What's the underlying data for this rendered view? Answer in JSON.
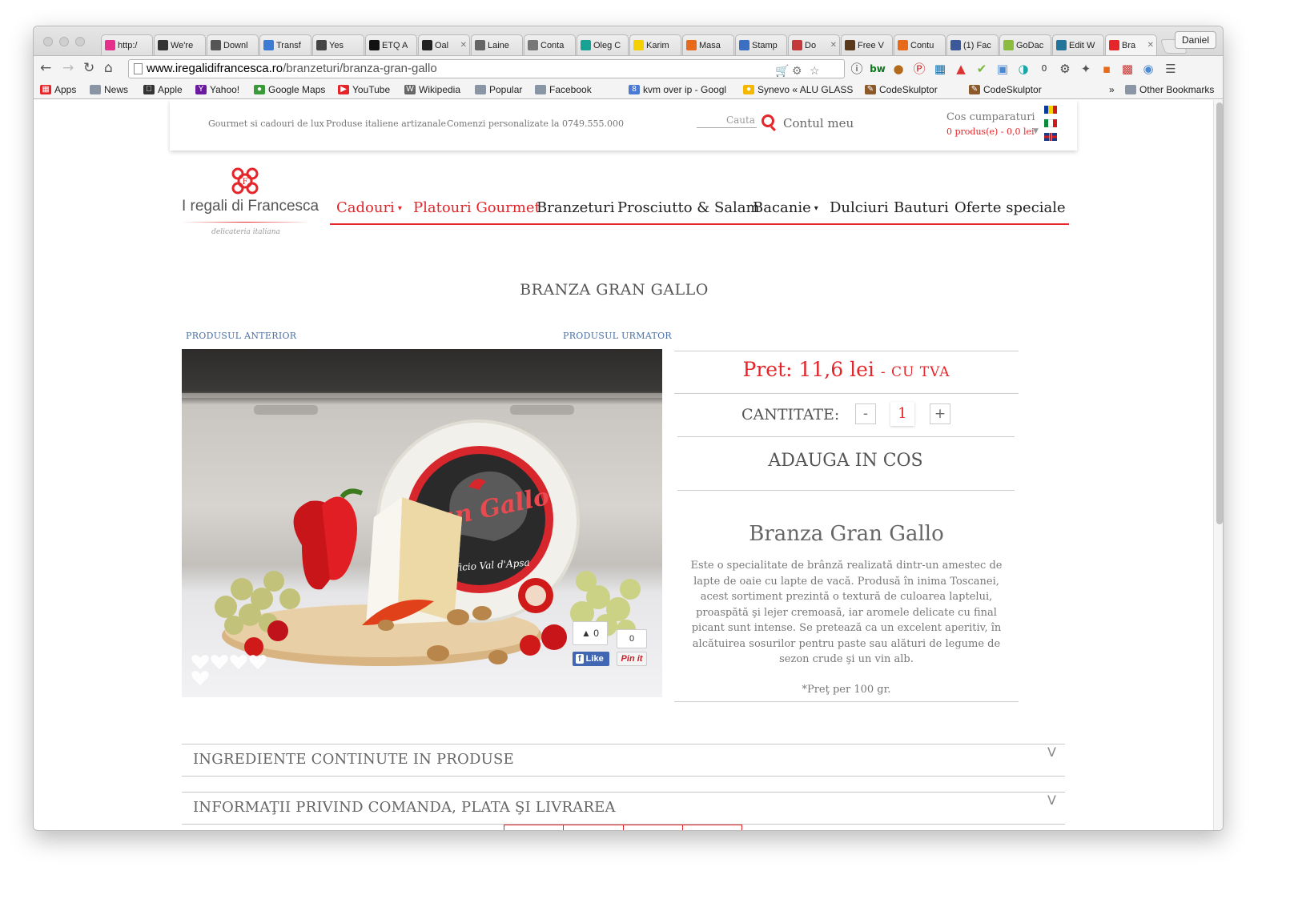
{
  "browser": {
    "tabs": [
      {
        "title": "http:/",
        "color": "#e6318c"
      },
      {
        "title": "We're",
        "color": "#333333"
      },
      {
        "title": "Downl",
        "color": "#555555"
      },
      {
        "title": "Transf",
        "color": "#3b7bd4"
      },
      {
        "title": "Yes",
        "color": "#444444"
      },
      {
        "title": "ETQ A",
        "color": "#111111"
      },
      {
        "title": "Oal",
        "color": "#222222"
      },
      {
        "title": "Laine",
        "color": "#666666"
      },
      {
        "title": "Conta",
        "color": "#777777"
      },
      {
        "title": "Oleg C",
        "color": "#17a294"
      },
      {
        "title": "Karim",
        "color": "#f5d000"
      },
      {
        "title": "Masa",
        "color": "#e66a1a"
      },
      {
        "title": "Stamp",
        "color": "#3a6fc4"
      },
      {
        "title": "Do",
        "color": "#c43a3a"
      },
      {
        "title": "Free V",
        "color": "#5a3a1a"
      },
      {
        "title": "Contu",
        "color": "#e66a1a"
      },
      {
        "title": "(1) Fac",
        "color": "#3b5998"
      },
      {
        "title": "GoDac",
        "color": "#8bbc3e"
      },
      {
        "title": "Edit W",
        "color": "#21759b"
      },
      {
        "title": "Bra",
        "color": "#e5252a"
      }
    ],
    "user_label": "Daniel",
    "url_domain": "www.iregalidifrancesca.ro",
    "url_path": "/branzeturi/branza-gran-gallo",
    "bookmarks": [
      "Apps",
      "News",
      "Apple",
      "Yahoo!",
      "Google Maps",
      "YouTube",
      "Wikipedia",
      "Popular",
      "Facebook",
      "kvm over ip - Googl",
      "Synevo « ALU GLASS",
      "CodeSkulptor",
      "CodeSkulptor"
    ],
    "bookmarks_overflow": "»",
    "other_bookmarks": "Other Bookmarks"
  },
  "site": {
    "top_links": [
      "Gourmet si cadouri de lux",
      "Produse italiene artizanale",
      "Comenzi personalizate la 0749.555.000"
    ],
    "search_placeholder": "Cauta",
    "account_label": "Contul meu",
    "cart_title": "Cos cumparaturi",
    "cart_summary": "0 produs(e) - 0,0 lei",
    "logo_name": "I regali di Francesca",
    "logo_tagline": "delicateria italiana",
    "nav": [
      {
        "label": "Cadouri",
        "dropdown": true,
        "active": true
      },
      {
        "label": "Platouri Gourmet",
        "dropdown": false,
        "active": true
      },
      {
        "label": "Branzeturi",
        "dropdown": false,
        "active": false
      },
      {
        "label": "Prosciutto & Salam",
        "dropdown": false,
        "active": false
      },
      {
        "label": "Bacanie",
        "dropdown": true,
        "active": false
      },
      {
        "label": "Dulciuri",
        "dropdown": false,
        "active": false
      },
      {
        "label": "Bauturi",
        "dropdown": false,
        "active": false
      },
      {
        "label": "Oferte speciale",
        "dropdown": false,
        "active": false
      }
    ],
    "accent_color": "#e5252a"
  },
  "product": {
    "page_title": "BRANZA GRAN GALLO",
    "prev_label": "PRODUSUL ANTERIOR",
    "next_label": "PRODUSUL URMATOR",
    "price_label": "Pret: 11,6 lei",
    "price_suffix": "- CU TVA",
    "quantity_label": "CANTITATE:",
    "quantity_minus": "-",
    "quantity_value": "1",
    "quantity_plus": "+",
    "add_to_cart": "ADAUGA IN COS",
    "name": "Branza Gran Gallo",
    "description": "Este o specialitate de brânză realizată dintr-un amestec de lapte de oaie cu lapte de vacă. Produsă în inima Toscanei, acest sortiment prezintă o textură de culoarea laptelui, proaspătă şi lejer cremoasă, iar aromele delicate cu final picant sunt intense. Se pretează ca un excelent aperitiv, în alcătuirea sosurilor pentru paste sau alături de legume de sezon crude şi un vin alb.",
    "price_note": "*Preţ per 100 gr.",
    "image": {
      "label_brand": "Gran Gallo",
      "label_maker": "Caseificio Val d'Apsa",
      "fb_count": "0",
      "fb_like": "Like",
      "pin_count": "0",
      "pin_label": "Pin it",
      "hearts": 5
    }
  },
  "accordions": [
    {
      "title": "INGREDIENTE CONTINUTE IN PRODUSE",
      "toggle": "V"
    },
    {
      "title": "INFORMAŢII PRIVIND COMANDA, PLATA ŞI LIVRAREA",
      "toggle": "V"
    }
  ]
}
